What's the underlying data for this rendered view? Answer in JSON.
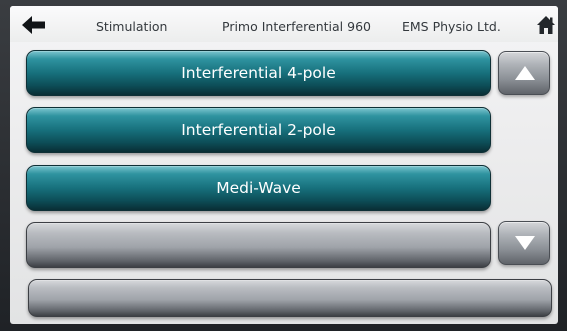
{
  "header": {
    "breadcrumb": "Stimulation",
    "device_name": "Primo Interferential 960",
    "manufacturer": "EMS Physio Ltd."
  },
  "icons": {
    "back": "back-arrow-icon",
    "home": "home-icon",
    "scroll_up": "triangle-up-icon",
    "scroll_down": "triangle-down-icon"
  },
  "menu": {
    "items": [
      {
        "label": "Interferential 4-pole"
      },
      {
        "label": "Interferential 2-pole"
      },
      {
        "label": "Medi-Wave"
      },
      {
        "label": ""
      },
      {
        "label": ""
      }
    ]
  },
  "colors": {
    "accent_teal": "#17707c",
    "empty_button": "#9fa3a9",
    "screen_bg": "#ededee",
    "text_dark": "#34393e"
  }
}
